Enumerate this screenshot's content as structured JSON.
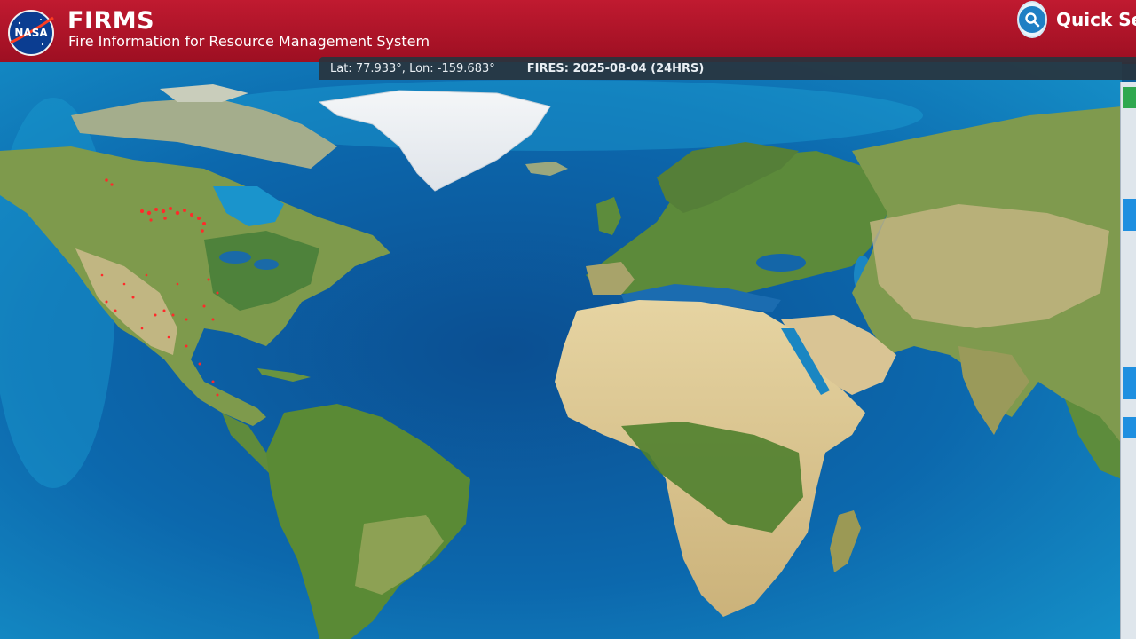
{
  "header": {
    "logo_text": "NASA",
    "title": "FIRMS",
    "subtitle": "Fire Information for Resource Management System",
    "quick_search_label": "Quick Se"
  },
  "infobar": {
    "coords": "Lat: 77.933°, Lon: -159.683°",
    "fires": "FIRES: 2025-08-04 (24HRS)"
  },
  "map": {
    "layer": "satellite-basemap",
    "fire_color": "#ff2a2a",
    "ocean_color": "#0a5f9c"
  },
  "icons": {
    "logo": "nasa-meatball-icon",
    "search": "search-icon"
  }
}
